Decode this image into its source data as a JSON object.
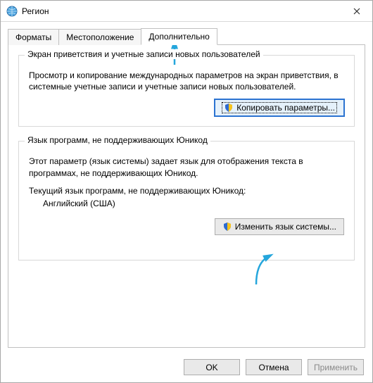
{
  "window": {
    "title": "Регион"
  },
  "tabs": {
    "formats": "Форматы",
    "location": "Местоположение",
    "advanced": "Дополнительно"
  },
  "group_welcome": {
    "legend": "Экран приветствия и учетные записи новых пользователей",
    "text": "Просмотр и копирование международных параметров на экран приветствия, в системные учетные записи и учетные записи новых пользователей.",
    "copy_button": "Копировать параметры..."
  },
  "group_nonunicode": {
    "legend": "Язык программ, не поддерживающих Юникод",
    "text": "Этот параметр (язык системы) задает язык для отображения текста в программах, не поддерживающих Юникод.",
    "current_label": "Текущий язык программ, не поддерживающих Юникод:",
    "current_value": "Английский (США)",
    "change_button": "Изменить язык системы..."
  },
  "footer": {
    "ok": "OK",
    "cancel": "Отмена",
    "apply": "Применить"
  },
  "colors": {
    "arrow": "#25a6dc"
  }
}
